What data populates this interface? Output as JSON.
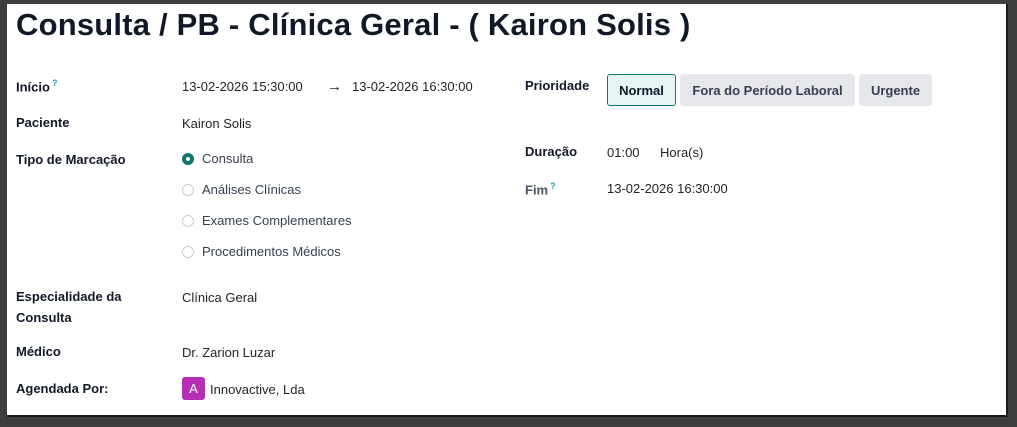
{
  "title": "Consulta / PB - Clínica Geral - ( Kairon Solis )",
  "help_mark": "?",
  "inicio": {
    "label": "Início",
    "start": "13-02-2026 15:30:00",
    "arrow": "→",
    "end": "13-02-2026 16:30:00"
  },
  "paciente": {
    "label": "Paciente",
    "value": "Kairon Solis"
  },
  "tipo_marcacao": {
    "label": "Tipo de Marcação",
    "options": [
      {
        "label": "Consulta",
        "checked": true
      },
      {
        "label": "Análises Clínicas",
        "checked": false
      },
      {
        "label": "Exames Complementares",
        "checked": false
      },
      {
        "label": "Procedimentos Médicos",
        "checked": false
      }
    ]
  },
  "especialidade": {
    "label_line1": "Especialidade da",
    "label_line2": "Consulta",
    "value": "Clínica Geral"
  },
  "medico": {
    "label": "Médico",
    "value": "Dr. Zarion Luzar"
  },
  "agendada_por": {
    "label": "Agendada Por:",
    "avatar_letter": "A",
    "value": "Innovactive, Lda",
    "avatar_color": "#b62fb5"
  },
  "prioridade": {
    "label": "Prioridade",
    "options": [
      "Normal",
      "Fora do Período Laboral",
      "Urgente"
    ],
    "selected": "Normal"
  },
  "duracao": {
    "label": "Duração",
    "value": "01:00",
    "unit": "Hora(s)"
  },
  "fim": {
    "label": "Fim",
    "value": "13-02-2026 16:30:00"
  },
  "colors": {
    "accent": "#0f766e",
    "help": "#17a2b8"
  }
}
